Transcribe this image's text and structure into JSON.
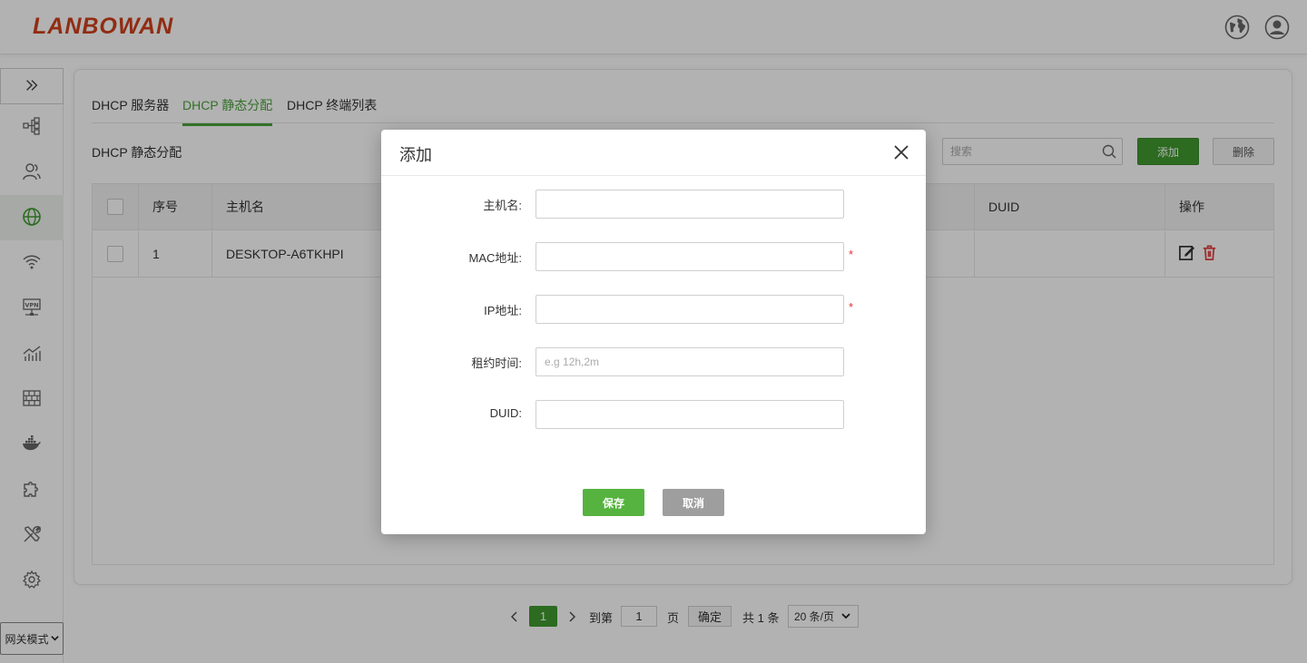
{
  "header": {
    "logo": "LANBOWAN",
    "icons": [
      "globe-icon",
      "user-icon"
    ]
  },
  "sidebar": {
    "toggle_icon": "double-chevron-right-icon",
    "items": [
      {
        "icon": "topology-icon"
      },
      {
        "icon": "users-icon"
      },
      {
        "icon": "globe-icon",
        "active": true
      },
      {
        "icon": "wifi-icon"
      },
      {
        "icon": "vpn-icon"
      },
      {
        "icon": "chart-icon"
      },
      {
        "icon": "firewall-icon"
      },
      {
        "icon": "docker-icon"
      },
      {
        "icon": "puzzle-icon"
      },
      {
        "icon": "tools-icon"
      },
      {
        "icon": "gear-icon"
      }
    ],
    "mode_select": "网关模式"
  },
  "tabs": [
    {
      "label": "DHCP 服务器"
    },
    {
      "label": "DHCP 静态分配",
      "active": true
    },
    {
      "label": "DHCP 终端列表"
    }
  ],
  "section_title": "DHCP 静态分配",
  "toolbar": {
    "search_placeholder": "搜索",
    "add_label": "添加",
    "delete_label": "删除"
  },
  "table": {
    "columns": [
      "",
      "序号",
      "主机名",
      "DUID",
      "操作"
    ],
    "rows": [
      {
        "index": "1",
        "hostname": "DESKTOP-A6TKHPI",
        "duid": ""
      }
    ]
  },
  "pagination": {
    "current": "1",
    "goto_label": "到第",
    "goto_value": "1",
    "page_label": "页",
    "confirm_label": "确定",
    "total": "共 1 条",
    "page_size": "20 条/页"
  },
  "modal": {
    "title": "添加",
    "fields": [
      {
        "label": "主机名:",
        "value": "",
        "placeholder": "",
        "required": false
      },
      {
        "label": "MAC地址:",
        "value": "",
        "placeholder": "",
        "required": true
      },
      {
        "label": "IP地址:",
        "value": "",
        "placeholder": "",
        "required": true
      },
      {
        "label": "租约时间:",
        "value": "",
        "placeholder": "e.g 12h,2m",
        "required": false
      },
      {
        "label": "DUID:",
        "value": "",
        "placeholder": "",
        "required": false
      }
    ],
    "required_mark": "*",
    "save_label": "保存",
    "cancel_label": "取消"
  },
  "colors": {
    "brand": "#d0401b",
    "accent": "#3f9a2f",
    "save": "#56b33f",
    "cancel": "#9e9e9e",
    "required": "#e03030"
  }
}
